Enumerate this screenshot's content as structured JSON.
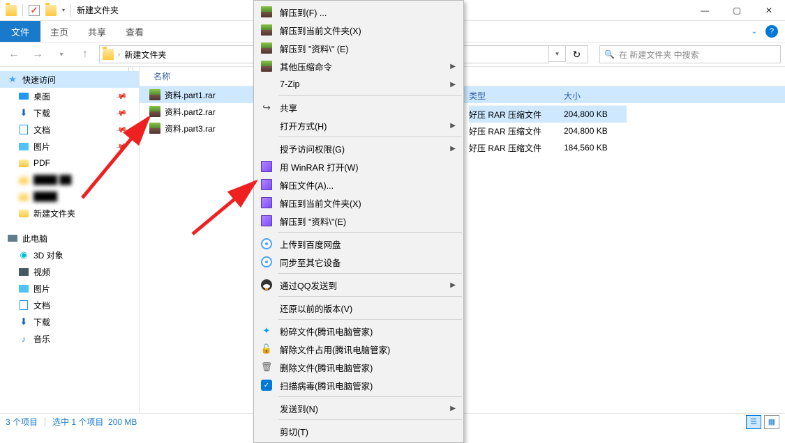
{
  "window": {
    "title": "新建文件夹",
    "folder_name": "新建文件夹"
  },
  "ribbon": {
    "file": "文件",
    "tabs": [
      "主页",
      "共享",
      "查看"
    ]
  },
  "address": {
    "crumb": "新建文件夹",
    "search_placeholder": "在 新建文件夹 中搜索"
  },
  "columns": {
    "name": "名称",
    "type": "类型",
    "size": "大小"
  },
  "nav": {
    "quick_access": "快速访问",
    "desktop": "桌面",
    "downloads": "下载",
    "documents": "文档",
    "pictures": "图片",
    "pdf": "PDF",
    "new_folder": "新建文件夹",
    "this_pc": "此电脑",
    "objects_3d": "3D 对象",
    "videos": "视频",
    "pictures2": "图片",
    "documents2": "文档",
    "downloads2": "下载",
    "music": "音乐"
  },
  "files": [
    {
      "name": "资料.part1.rar",
      "type": "好压 RAR 压缩文件",
      "size": "204,800 KB",
      "selected": true
    },
    {
      "name": "资料.part2.rar",
      "type": "好压 RAR 压缩文件",
      "size": "204,800 KB",
      "selected": false
    },
    {
      "name": "资料.part3.rar",
      "type": "好压 RAR 压缩文件",
      "size": "184,560 KB",
      "selected": false
    }
  ],
  "status": {
    "items": "3 个项目",
    "selected": "选中 1 个项目",
    "size": "200 MB"
  },
  "context_menu": {
    "items": [
      {
        "icon": "rar",
        "label": "解压到(F) ..."
      },
      {
        "icon": "rar",
        "label": "解压到当前文件夹(X)"
      },
      {
        "icon": "rar",
        "label": "解压到 \"资料\\\" (E)"
      },
      {
        "icon": "rar",
        "label": "其他压缩命令",
        "submenu": true
      },
      {
        "icon": "",
        "label": "7-Zip",
        "submenu": true
      },
      {
        "sep": true
      },
      {
        "icon": "share",
        "label": "共享"
      },
      {
        "icon": "",
        "label": "打开方式(H)",
        "submenu": true
      },
      {
        "sep": true
      },
      {
        "icon": "",
        "label": "授予访问权限(G)",
        "submenu": true
      },
      {
        "icon": "winrar",
        "label": "用 WinRAR 打开(W)"
      },
      {
        "icon": "winrar",
        "label": "解压文件(A)..."
      },
      {
        "icon": "winrar",
        "label": "解压到当前文件夹(X)"
      },
      {
        "icon": "winrar",
        "label": "解压到 \"资料\\\"(E)"
      },
      {
        "sep": true
      },
      {
        "icon": "baidu",
        "label": "上传到百度网盘"
      },
      {
        "icon": "baidu",
        "label": "同步至其它设备"
      },
      {
        "sep": true
      },
      {
        "icon": "qq",
        "label": "通过QQ发送到",
        "submenu": true
      },
      {
        "sep": true
      },
      {
        "icon": "",
        "label": "还原以前的版本(V)"
      },
      {
        "sep": true
      },
      {
        "icon": "tx",
        "label": "粉碎文件(腾讯电脑管家)"
      },
      {
        "icon": "lock",
        "label": "解除文件占用(腾讯电脑管家)"
      },
      {
        "icon": "trash",
        "label": "删除文件(腾讯电脑管家)"
      },
      {
        "icon": "shield",
        "label": "扫描病毒(腾讯电脑管家)"
      },
      {
        "sep": true
      },
      {
        "icon": "",
        "label": "发送到(N)",
        "submenu": true
      },
      {
        "sep": true
      },
      {
        "icon": "",
        "label": "剪切(T)"
      }
    ]
  }
}
